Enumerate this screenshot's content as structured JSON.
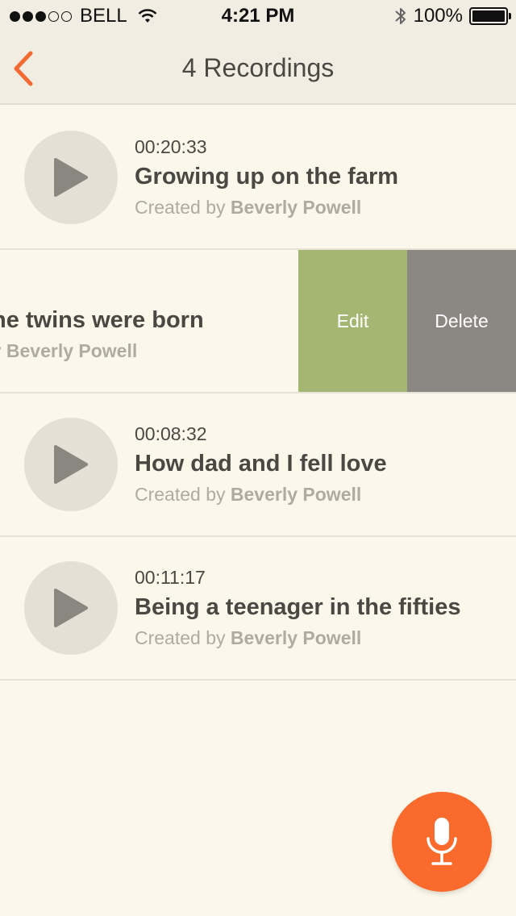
{
  "status_bar": {
    "carrier": "BELL",
    "time": "4:21 PM",
    "battery": "100%",
    "signal_bars": 3,
    "signal_total": 5
  },
  "nav": {
    "title": "4 Recordings",
    "back_icon": "chevron-left-icon",
    "accent": "#f26b35"
  },
  "recordings": [
    {
      "duration": "00:20:33",
      "title": "Growing up on the farm",
      "created_prefix": "Created by",
      "author": "Beverly Powell"
    },
    {
      "duration": "",
      "title": "he twins were born",
      "created_prefix": "y",
      "author": "Beverly Powell"
    },
    {
      "duration": "00:08:32",
      "title": "How dad and I fell love",
      "created_prefix": "Created by",
      "author": "Beverly Powell"
    },
    {
      "duration": "00:11:17",
      "title": "Being a teenager in the fifties",
      "created_prefix": "Created by",
      "author": "Beverly Powell"
    }
  ],
  "swipe_actions": {
    "edit_label": "Edit",
    "delete_label": "Delete",
    "edit_color": "#a3b772",
    "delete_color": "#8b8782"
  },
  "fab": {
    "icon": "microphone-icon",
    "color": "#fb6a2d"
  }
}
